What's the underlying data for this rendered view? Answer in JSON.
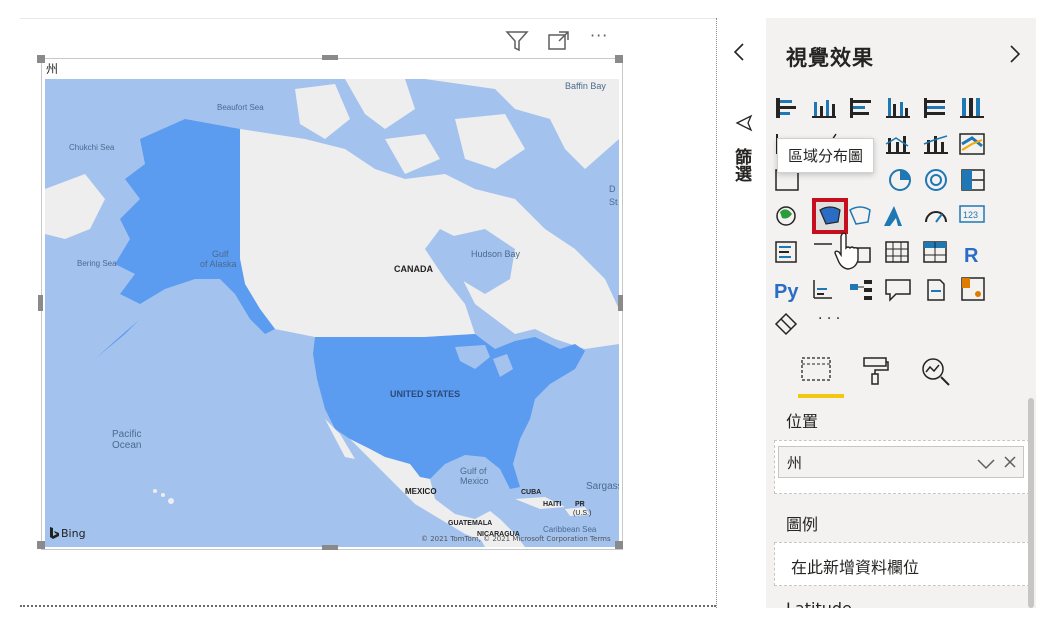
{
  "visual": {
    "title": "州",
    "header_icons": [
      "filter-icon",
      "focus-mode-icon",
      "more-options-icon"
    ]
  },
  "map": {
    "labels": {
      "baffin_bay": "Baffin Bay",
      "beaufort_sea": "Beaufort Sea",
      "chukchi_sea": "Chukchi Sea",
      "gulf_of_alaska_1": "Gulf",
      "gulf_of_alaska_2": "of Alaska",
      "bering_sea": "Bering Sea",
      "canada": "CANADA",
      "hudson_bay": "Hudson Bay",
      "united_states": "UNITED STATES",
      "pacific_ocean_1": "Pacific",
      "pacific_ocean_2": "Ocean",
      "gulf_of_mexico_1": "Gulf of",
      "gulf_of_mexico_2": "Mexico",
      "mexico": "MEXICO",
      "cuba": "CUBA",
      "haiti": "HAITI",
      "pr": "PR",
      "us": "(U.S.)",
      "sargasso": "Sargass",
      "guatemala": "GUATEMALA",
      "nicaragua": "NICARAGUA",
      "caribbean": "Caribbean Sea",
      "st": "St",
      "d": "D"
    },
    "attribution": "© 2021 TomTom, © 2021 Microsoft Corporation  Terms",
    "bing_logo": "Bing",
    "colors": {
      "water": "#a3c3ee",
      "land": "#eeeeee",
      "highlight": "#5b9bf0"
    }
  },
  "filters_pane": {
    "label": "篩選"
  },
  "viz_pane": {
    "title": "視覺效果",
    "collapse_icon": "chevron-left-icon",
    "expand_icon": "chevron-right-icon",
    "tooltip": "區域分布圖",
    "more_label": "· · ·",
    "tabs": [
      "fields-tab-icon",
      "format-tab-icon",
      "analytics-tab-icon"
    ],
    "location_label": "位置",
    "location_value": "州",
    "legend_label": "圖例",
    "legend_placeholder": "在此新增資料欄位",
    "partial_label": "Latitude",
    "accent": "#f2c811",
    "selected_border": "#c50f1f"
  }
}
